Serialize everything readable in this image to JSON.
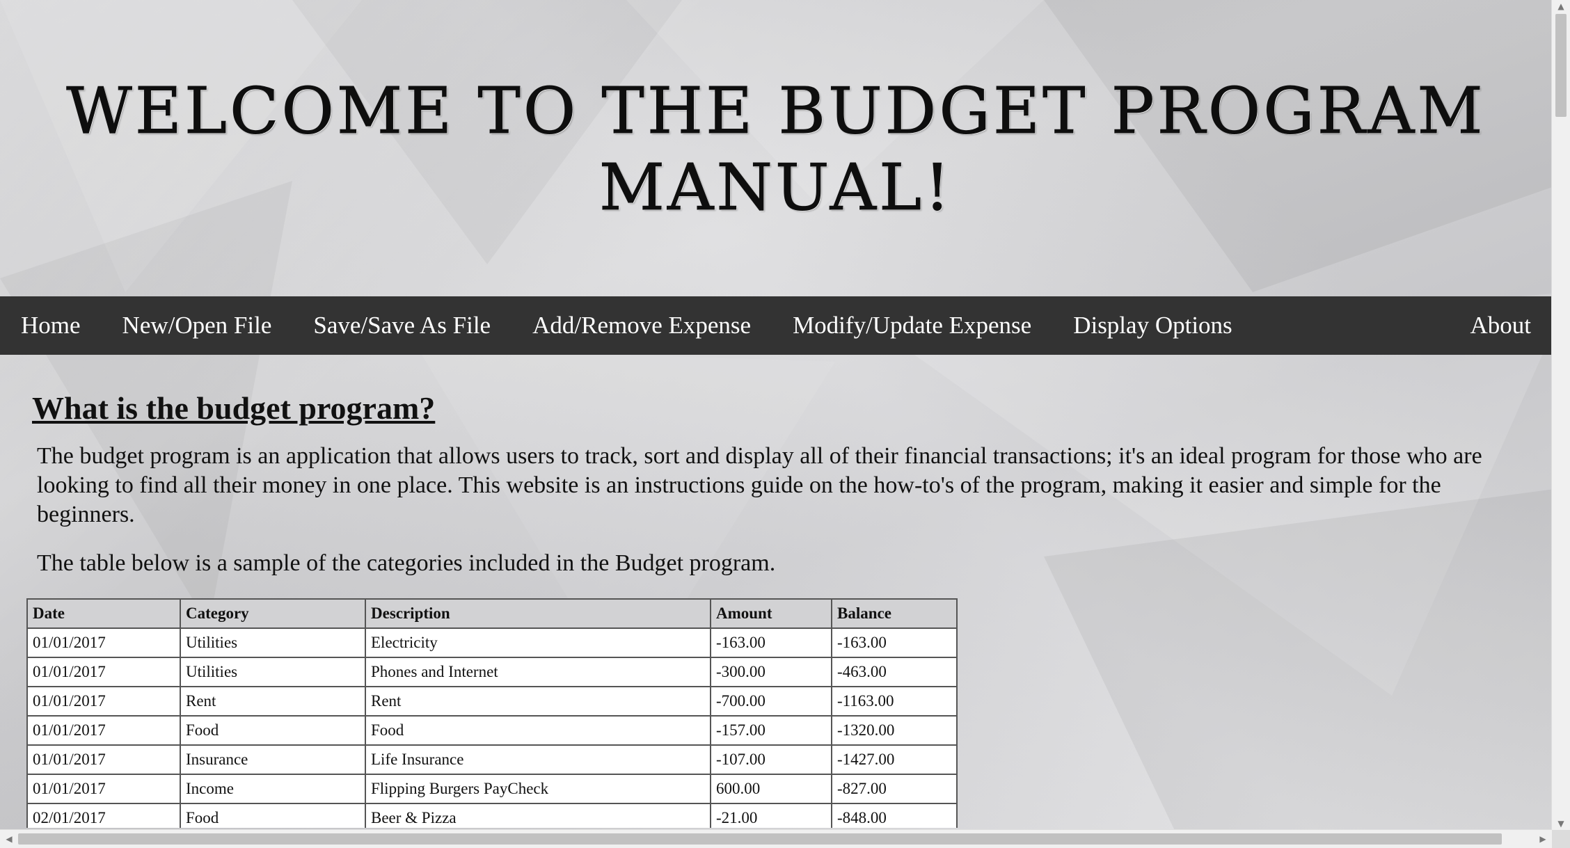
{
  "header": {
    "title_line1": "Welcome to the Budget Program",
    "title_line2": "Manual!"
  },
  "nav": {
    "items": [
      {
        "label": "Home"
      },
      {
        "label": "New/Open File"
      },
      {
        "label": "Save/Save As File"
      },
      {
        "label": "Add/Remove Expense"
      },
      {
        "label": "Modify/Update Expense"
      },
      {
        "label": "Display Options"
      }
    ],
    "about": "About"
  },
  "main": {
    "heading": "What is the budget program?",
    "intro": "The budget program is an application that allows users to track, sort and display all of their financial transactions; it's an ideal program for those who are looking to find all their money in one place. This website is an instructions guide on the how-to's of the program, making it easier and simple for the beginners.",
    "table_intro": "The table below is a sample of the categories included in the Budget program."
  },
  "table": {
    "headers": [
      "Date",
      "Category",
      "Description",
      "Amount",
      "Balance"
    ],
    "rows": [
      [
        "01/01/2017",
        "Utilities",
        "Electricity",
        "-163.00",
        "-163.00"
      ],
      [
        "01/01/2017",
        "Utilities",
        "Phones and Internet",
        "-300.00",
        "-463.00"
      ],
      [
        "01/01/2017",
        "Rent",
        "Rent",
        "-700.00",
        "-1163.00"
      ],
      [
        "01/01/2017",
        "Food",
        "Food",
        "-157.00",
        "-1320.00"
      ],
      [
        "01/01/2017",
        "Insurance",
        "Life Insurance",
        "-107.00",
        "-1427.00"
      ],
      [
        "01/01/2017",
        "Income",
        "Flipping Burgers PayCheck",
        "600.00",
        "-827.00"
      ],
      [
        "02/01/2017",
        "Food",
        "Beer & Pizza",
        "-21.00",
        "-848.00"
      ]
    ]
  },
  "colors": {
    "nav_background": "#333333",
    "nav_text": "#ffffff",
    "table_header": "#d2d2d4"
  }
}
